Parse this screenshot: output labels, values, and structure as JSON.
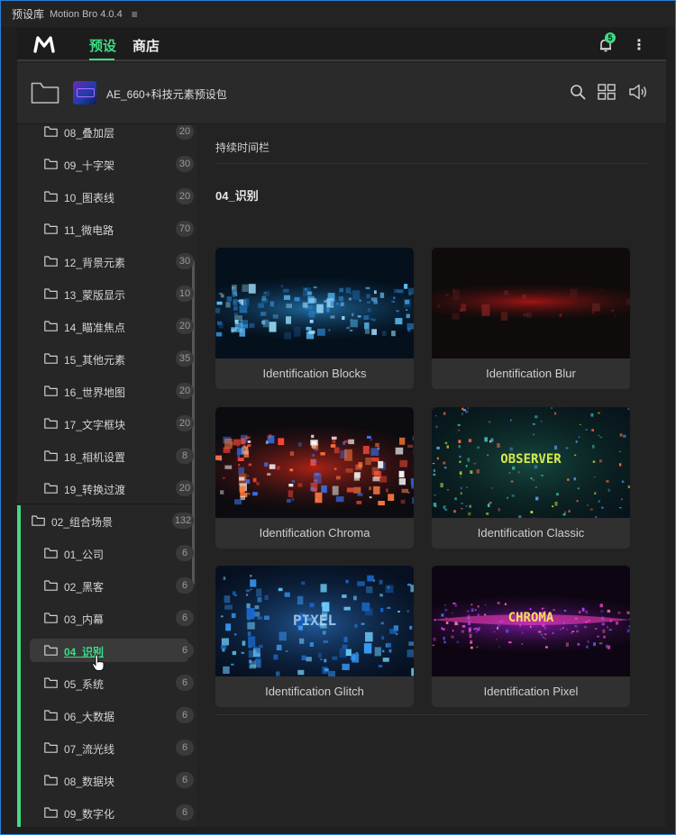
{
  "titlebar": {
    "title": "预设库",
    "version": "Motion Bro 4.0.4",
    "menu_glyph": "≡"
  },
  "nav": {
    "tabs": [
      {
        "label": "预设",
        "active": true
      },
      {
        "label": "商店",
        "active": false
      }
    ],
    "notification_count": "5",
    "more_glyph": "⋮",
    "accent_color": "#3ddc84"
  },
  "pack": {
    "title": "AE_660+科技元素预设包"
  },
  "sidebar": {
    "items": [
      {
        "label": "08_叠加层",
        "count": "20"
      },
      {
        "label": "09_十字架",
        "count": "30"
      },
      {
        "label": "10_图表线",
        "count": "20"
      },
      {
        "label": "11_微电路",
        "count": "70"
      },
      {
        "label": "12_背景元素",
        "count": "30"
      },
      {
        "label": "13_蒙版显示",
        "count": "10"
      },
      {
        "label": "14_瞄准焦点",
        "count": "20"
      },
      {
        "label": "15_其他元素",
        "count": "35"
      },
      {
        "label": "16_世界地图",
        "count": "20"
      },
      {
        "label": "17_文字框块",
        "count": "20"
      },
      {
        "label": "18_相机设置",
        "count": "8"
      },
      {
        "label": "19_转换过渡",
        "count": "20"
      }
    ],
    "group": {
      "label": "02_组合场景",
      "count": "132"
    },
    "subitems": [
      {
        "label": "01_公司",
        "count": "6"
      },
      {
        "label": "02_黑客",
        "count": "6"
      },
      {
        "label": "03_内幕",
        "count": "6"
      },
      {
        "label": "04_识别",
        "count": "6",
        "selected": true
      },
      {
        "label": "05_系统",
        "count": "6"
      },
      {
        "label": "06_大数据",
        "count": "6"
      },
      {
        "label": "07_流光线",
        "count": "6"
      },
      {
        "label": "08_数据块",
        "count": "6"
      },
      {
        "label": "09_数字化",
        "count": "6"
      }
    ]
  },
  "content": {
    "previous_section": "持续时间栏",
    "section_title": "04_识别",
    "cards": [
      {
        "title": "Identification Blocks"
      },
      {
        "title": "Identification Blur"
      },
      {
        "title": "Identification Chroma"
      },
      {
        "title": "Identification Classic",
        "thumb_text": "OBSERVER"
      },
      {
        "title": "Identification Glitch",
        "thumb_text": "PIXEL"
      },
      {
        "title": "Identification Pixel",
        "thumb_text": "CHROMA"
      }
    ]
  }
}
